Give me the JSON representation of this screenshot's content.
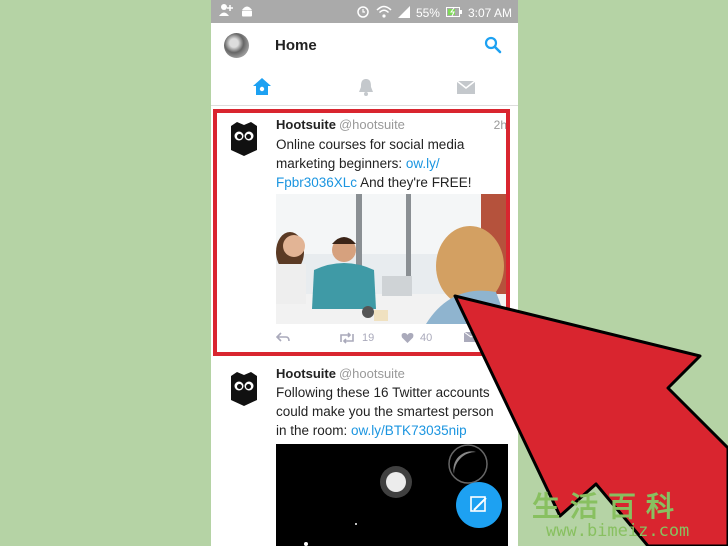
{
  "status_bar": {
    "battery": "55%",
    "time": "3:07 AM"
  },
  "header": {
    "title": "Home"
  },
  "tabs": [
    {
      "icon": "home-icon",
      "active": true
    },
    {
      "icon": "bell-icon",
      "active": false
    },
    {
      "icon": "envelope-icon",
      "active": false
    }
  ],
  "tweets": [
    {
      "name": "Hootsuite",
      "handle": "@hootsuite",
      "time": "2h",
      "text_lines": [
        "Online courses for social media",
        "marketing beginners: "
      ],
      "link1": "ow.ly/",
      "link2": "Fpbr3036XLc",
      "text_tail": " And they're FREE!",
      "retweets": "19",
      "likes": "40"
    },
    {
      "name": "Hootsuite",
      "handle": "@hootsuite",
      "text_lines": [
        "Following these 16 Twitter accounts",
        "could make you the smartest person",
        "in the room: "
      ],
      "link": "ow.ly/BTK73035nip"
    }
  ],
  "watermark": {
    "chinese": "生活百科",
    "url": "www.bimeiz.com"
  },
  "colors": {
    "background": "#b5d3a5",
    "accent": "#1da1f2",
    "highlight": "#d9252f",
    "status_bar": "#aaaaaa"
  }
}
